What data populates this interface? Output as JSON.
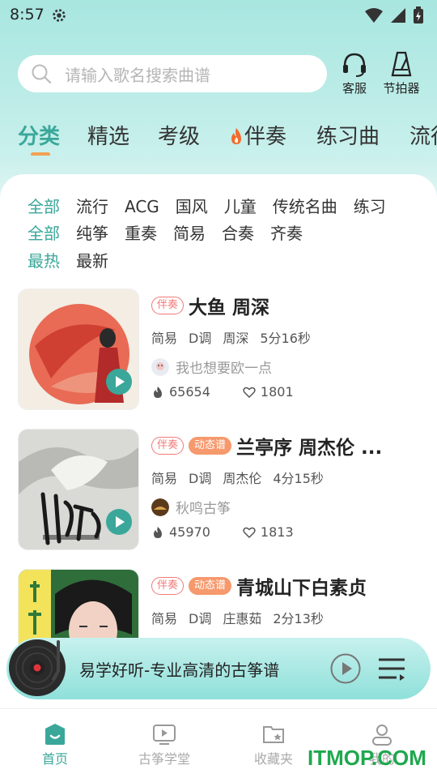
{
  "status": {
    "time": "8:57"
  },
  "search": {
    "placeholder": "请输入歌名搜索曲谱"
  },
  "top_actions": {
    "service": "客服",
    "metronome": "节拍器"
  },
  "main_tabs": [
    "分类",
    "精选",
    "考级",
    "伴奏",
    "练习曲",
    "流行"
  ],
  "filters": {
    "row1": [
      "全部",
      "流行",
      "ACG",
      "国风",
      "儿童",
      "传统名曲",
      "练习"
    ],
    "row2": [
      "全部",
      "纯筝",
      "重奏",
      "简易",
      "合奏",
      "齐奏"
    ],
    "row3": [
      "最热",
      "最新"
    ]
  },
  "songs": [
    {
      "badges": [
        "伴奏"
      ],
      "title": "大鱼 周深",
      "level": "简易",
      "key": "D调",
      "artist": "周深",
      "duration": "5分16秒",
      "uploader": "我也想要欧一点",
      "heat": "65654",
      "likes": "1801"
    },
    {
      "badges": [
        "伴奏",
        "动态谱"
      ],
      "title": "兰亭序 周杰伦 ...",
      "level": "简易",
      "key": "D调",
      "artist": "周杰伦",
      "duration": "4分15秒",
      "uploader": "秋鸣古筝",
      "heat": "45970",
      "likes": "1813"
    },
    {
      "badges": [
        "伴奏",
        "动态谱"
      ],
      "title": "青城山下白素贞",
      "level": "简易",
      "key": "D调",
      "artist": "庄惠茹",
      "duration": "2分13秒"
    }
  ],
  "player": {
    "text": "易学好听-专业高清的古筝谱"
  },
  "bottom_nav": [
    "首页",
    "古筝学堂",
    "收藏夹",
    "我的"
  ],
  "watermark": "ITMOP.COM",
  "colors": {
    "accent": "#3aa79a",
    "badge_red": "#f07a78",
    "badge_orange": "#f6996d"
  }
}
